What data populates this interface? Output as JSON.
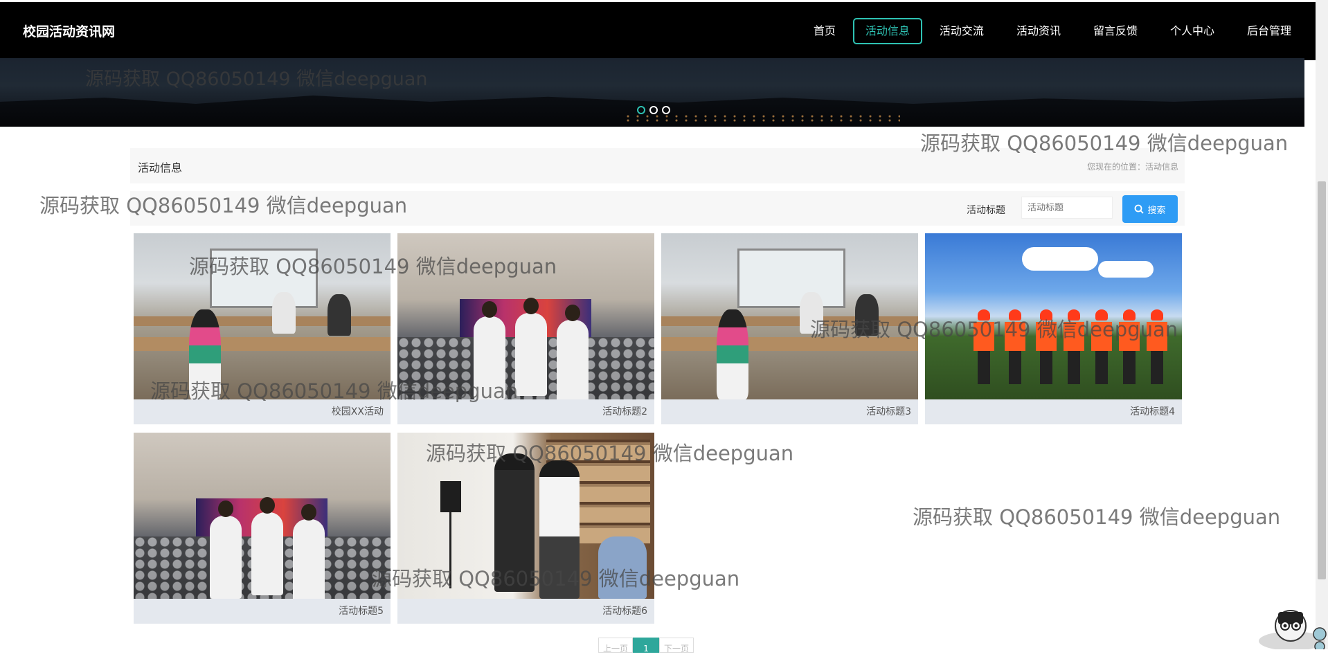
{
  "nav": {
    "brand": "校园活动资讯网",
    "items": [
      {
        "label": "首页",
        "active": false
      },
      {
        "label": "活动信息",
        "active": true
      },
      {
        "label": "活动交流",
        "active": false
      },
      {
        "label": "活动资讯",
        "active": false
      },
      {
        "label": "留言反馈",
        "active": false
      },
      {
        "label": "个人中心",
        "active": false
      },
      {
        "label": "后台管理",
        "active": false
      }
    ]
  },
  "banner": {
    "slide_count": 3,
    "active_slide": 1
  },
  "section": {
    "title": "活动信息",
    "breadcrumb": "您现在的位置：活动信息"
  },
  "search": {
    "label": "活动标题",
    "placeholder": "活动标题",
    "button": "搜索"
  },
  "cards": [
    {
      "title": "校园XX活动",
      "photo": "classroom"
    },
    {
      "title": "活动标题2",
      "photo": "hall"
    },
    {
      "title": "活动标题3",
      "photo": "classroom"
    },
    {
      "title": "活动标题4",
      "photo": "outdoor"
    },
    {
      "title": "活动标题5",
      "photo": "hall"
    },
    {
      "title": "活动标题6",
      "photo": "library"
    }
  ],
  "pagination": {
    "prev": "上一页",
    "current": "1",
    "next": "下一页"
  },
  "watermark": "源码获取 QQ86050149 微信deepguan",
  "colors": {
    "accent": "#2ec2b3",
    "search_button": "#2e9cf5",
    "nav_bg": "#000000",
    "panel_bg": "#f7f7f7"
  }
}
